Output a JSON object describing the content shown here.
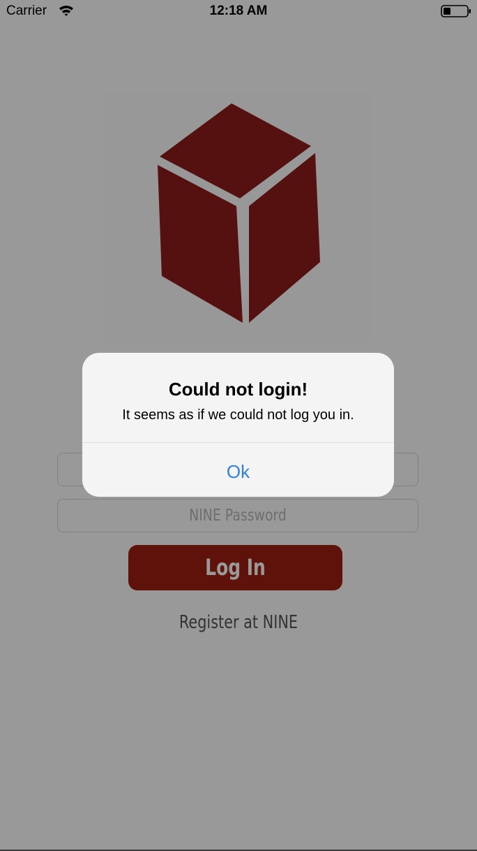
{
  "status_bar": {
    "carrier": "Carrier",
    "time": "12:18 AM",
    "wifi_icon": "wifi-icon",
    "battery_icon": "battery-icon"
  },
  "login": {
    "logo_icon": "cube-logo-icon",
    "logo_color": "#8c1d1a",
    "username_placeholder": "",
    "password_placeholder": "NINE Password",
    "login_button_label": "Log In",
    "login_button_color": "#9e1e10",
    "register_link": "Register at NINE"
  },
  "alert": {
    "title": "Could not login!",
    "message": "It seems as if we could not log you in.",
    "ok_label": "Ok",
    "ok_color": "#2f7fe0"
  }
}
